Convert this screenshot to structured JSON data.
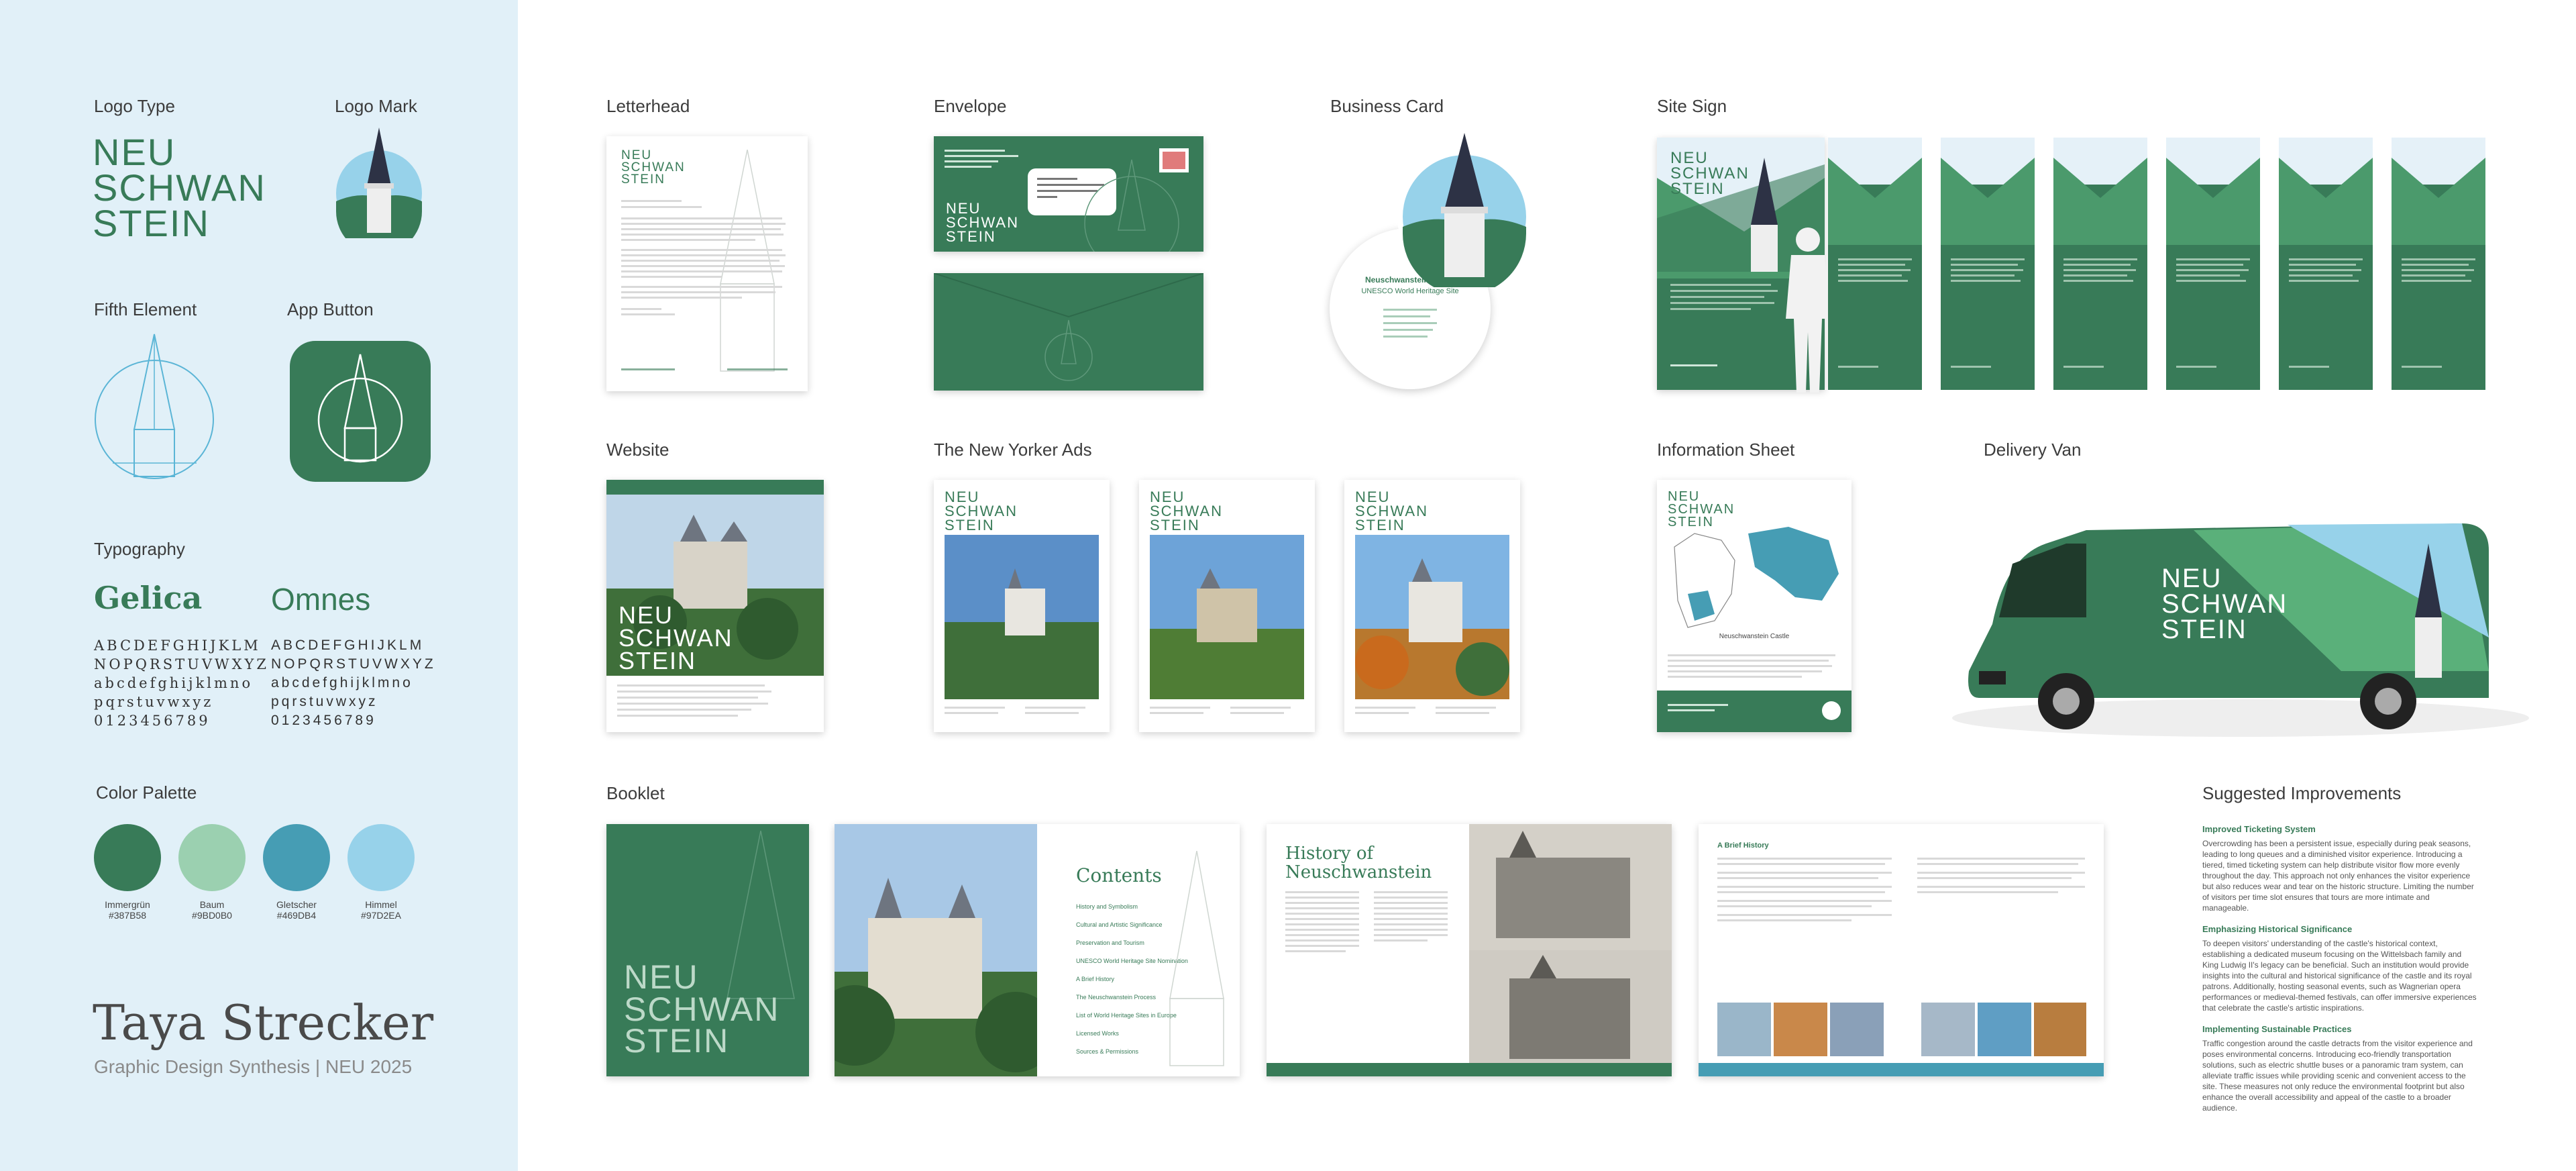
{
  "brand_colors": {
    "green": "#387B58",
    "sky": "#97D2EA",
    "mint": "#9BD0B0",
    "teal": "#469DB4",
    "panel": "#e1f0f8"
  },
  "left": {
    "logo_type_label": "Logo Type",
    "logo_mark_label": "Logo Mark",
    "logo_words": [
      "NEU",
      "SCHWAN",
      "STEIN"
    ],
    "fifth_element_label": "Fifth Element",
    "app_button_label": "App Button",
    "typography_label": "Typography",
    "fonts": [
      {
        "name": "Gelica",
        "lines": [
          "ABCDEFGHIJKLM",
          "NOPQRSTUVWXYZ",
          "abcdefghijklmno",
          "pqrstuvwxyz",
          "0123456789"
        ]
      },
      {
        "name": "Omnes",
        "lines": [
          "ABCDEFGHIJKLM",
          "NOPQRSTUVWXYZ",
          "abcdefghijklmno",
          "pqrstuvwxyz",
          "0123456789"
        ]
      }
    ],
    "palette_label": "Color Palette",
    "palette": [
      {
        "name": "Immergrün",
        "hex": "#387B58",
        "color": "#387B58"
      },
      {
        "name": "Baum",
        "hex": "#9BD0B0",
        "color": "#9BD0B0"
      },
      {
        "name": "Gletscher",
        "hex": "#469DB4",
        "color": "#469DB4"
      },
      {
        "name": "Himmel",
        "hex": "#97D2EA",
        "color": "#97D2EA"
      }
    ],
    "author": "Taya Strecker",
    "subtitle": "Graphic Design Synthesis | NEU 2025"
  },
  "sections": {
    "letterhead": "Letterhead",
    "envelope": "Envelope",
    "business_card": "Business Card",
    "site_sign": "Site Sign",
    "website": "Website",
    "ny_ads": "The New Yorker Ads",
    "info_sheet": "Information Sheet",
    "delivery_van": "Delivery Van",
    "booklet": "Booklet",
    "suggested": "Suggested Improvements"
  },
  "business_card": {
    "title": "Neuschwanstein Castle",
    "subtitle": "UNESCO World Heritage Site"
  },
  "info_sheet": {
    "map_label": "Neuschwanstein Castle"
  },
  "booklet": {
    "contents_title": "Contents",
    "contents_items": [
      "History and Symbolism",
      "Cultural and Artistic Significance",
      "Preservation and Tourism",
      "UNESCO World Heritage Site Nomination",
      "A Brief History",
      "The Neuschwanstein Process",
      "List of World Heritage Sites in Europe",
      "Licensed Works",
      "Sources & Permissions"
    ],
    "history_title_1": "History of",
    "history_title_2": "Neuschwanstein",
    "brief_history": "A Brief History"
  },
  "improvements": [
    {
      "title": "Improved Ticketing System",
      "body": "Overcrowding has been a persistent issue, especially during peak seasons, leading to long queues and a diminished visitor experience. Introducing a tiered, timed ticketing system can help distribute visitor flow more evenly throughout the day. This approach not only enhances the visitor experience but also reduces wear and tear on the historic structure. Limiting the number of visitors per time slot ensures that tours are more intimate and manageable."
    },
    {
      "title": "Emphasizing Historical Significance",
      "body": "To deepen visitors' understanding of the castle's historical context, establishing a dedicated museum focusing on the Wittelsbach family and King Ludwig II's legacy can be beneficial. Such an institution would provide insights into the cultural and historical significance of the castle and its royal patrons. Additionally, hosting seasonal events, such as Wagnerian opera performances or medieval-themed festivals, can offer immersive experiences that celebrate the castle's artistic inspirations."
    },
    {
      "title": "Implementing Sustainable Practices",
      "body": "Traffic congestion around the castle detracts from the visitor experience and poses environmental concerns. Introducing eco-friendly transportation solutions, such as electric shuttle buses or a panoramic tram system, can alleviate traffic issues while providing scenic and convenient access to the site. These measures not only reduce the environmental footprint but also enhance the overall accessibility and appeal of the castle to a broader audience."
    }
  ]
}
